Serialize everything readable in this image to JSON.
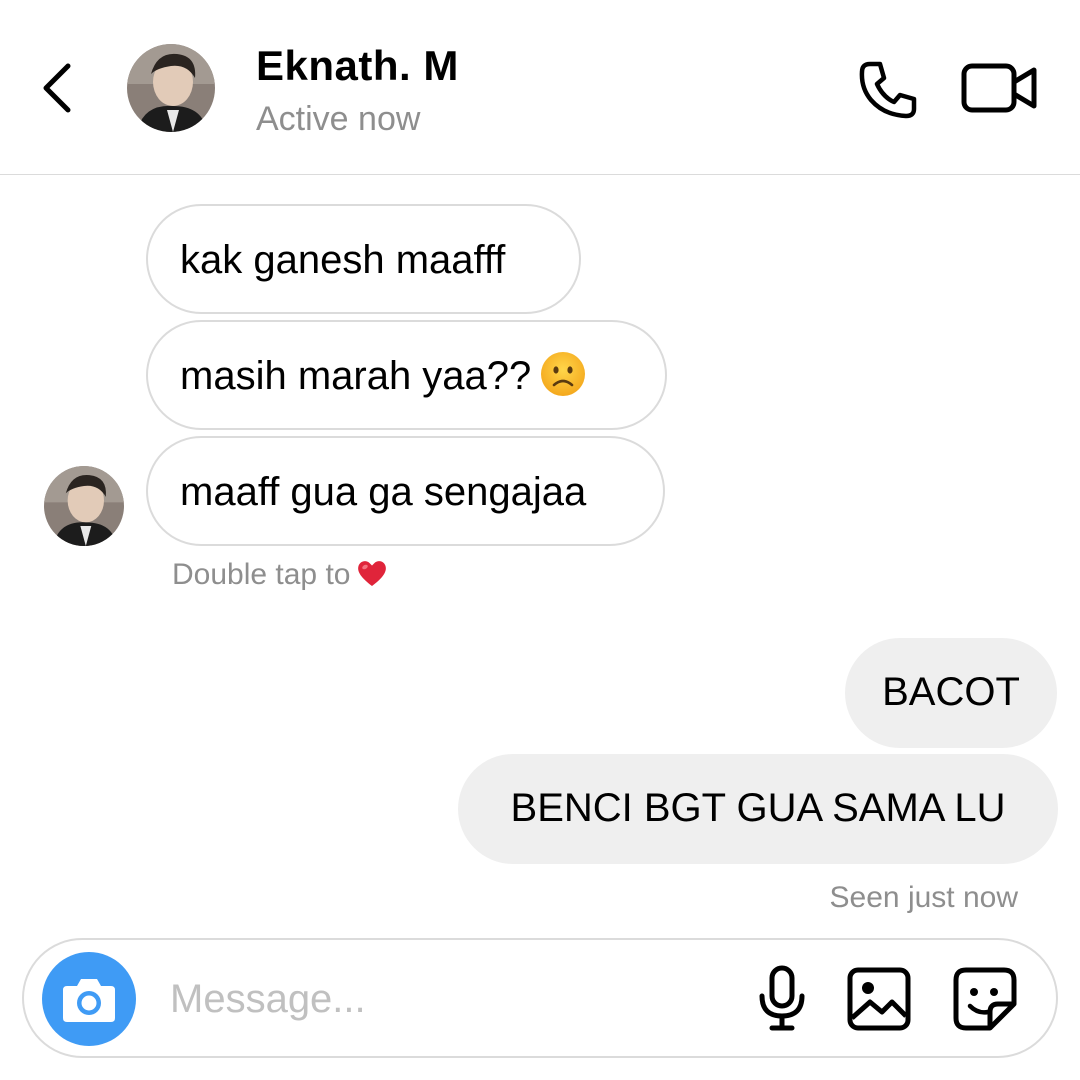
{
  "header": {
    "name": "Eknath. M",
    "status": "Active now"
  },
  "messages": {
    "incoming": [
      {
        "text": "kak ganesh maafff"
      },
      {
        "text": "masih marah yaa??",
        "emoji": "frowning-face"
      },
      {
        "text": "maaff gua ga sengajaa"
      }
    ],
    "double_tap_hint": "Double tap to",
    "outgoing": [
      {
        "text": "BACOT"
      },
      {
        "text": "BENCI BGT GUA SAMA LU"
      }
    ],
    "seen_status": "Seen just now"
  },
  "composer": {
    "placeholder": "Message..."
  },
  "icons": {
    "back": "chevron-left-icon",
    "call": "phone-icon",
    "video": "video-camera-icon",
    "camera": "camera-icon",
    "mic": "microphone-icon",
    "gallery": "image-icon",
    "sticker": "sticker-icon",
    "reaction": "heart-icon"
  },
  "colors": {
    "accent": "#3f9bf5",
    "secondary_text": "#8e8e8e",
    "outgoing_bubble": "#efefef",
    "border": "#dbdbdb",
    "heart": "#e0243a"
  }
}
